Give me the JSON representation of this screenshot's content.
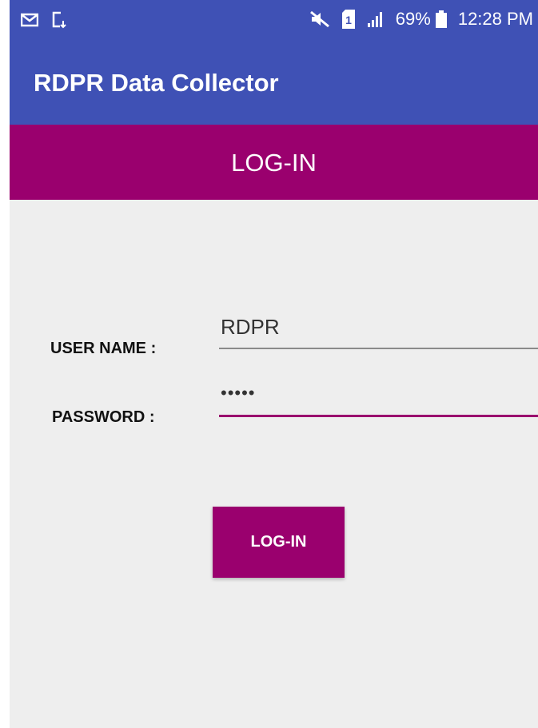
{
  "status_bar": {
    "left_icons": [
      "mail-icon",
      "download-icon"
    ],
    "right_icons": [
      "mute-icon",
      "sim-icon",
      "signal-icon"
    ],
    "battery_percent": "69%",
    "time": "12:28 PM"
  },
  "app_bar": {
    "title": "RDPR Data Collector"
  },
  "header": {
    "title": "LOG-IN"
  },
  "form": {
    "username": {
      "label": "USER NAME :",
      "value": "RDPR"
    },
    "password": {
      "label": "PASSWORD :",
      "value": "•••••"
    },
    "submit_label": "LOG-IN"
  },
  "colors": {
    "primary": "#3F51B5",
    "accent": "#9A006E",
    "background": "#EEEEEE"
  }
}
